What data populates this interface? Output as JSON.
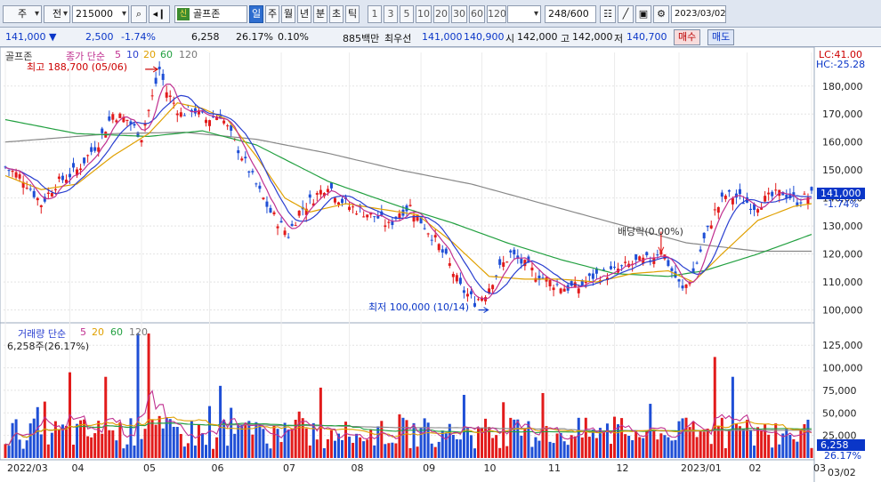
{
  "toolbar": {
    "mode": "주",
    "market": "전",
    "code": "215000",
    "badge": "신",
    "stock_name": "골프존",
    "periods": [
      "일",
      "주",
      "월",
      "년",
      "분",
      "초",
      "틱"
    ],
    "active_period": "일",
    "intervals": [
      "1",
      "3",
      "5",
      "10",
      "20",
      "30",
      "60",
      "120"
    ],
    "count": "248",
    "count_total": "/600",
    "date": "2023/03/02"
  },
  "quote": {
    "price": "141,000 ▼",
    "change": "2,500",
    "change_pct": "-1.74%",
    "volume": "6,258",
    "turnover": "26.17%",
    "ratio": "0.10%",
    "amount": "885백만",
    "best_bid_label": "최우선",
    "best_ask": "141,000",
    "best_bid": "140,900",
    "open_label": "시",
    "open": "142,000",
    "high_label": "고",
    "high": "142,000",
    "low_label": "저",
    "low": "140,700",
    "buy_label": "매수",
    "sell_label": "매도"
  },
  "price_panel": {
    "legend_name": "골프존",
    "legend_title": "종가 단순",
    "ma_periods": [
      "5",
      "10",
      "20",
      "60",
      "120"
    ],
    "ma_colors": [
      "#c03090",
      "#2a3fd0",
      "#e0a000",
      "#22a040",
      "#888888"
    ],
    "hc_labels": [
      "LC:41.00",
      "HC:-25.28"
    ],
    "max_label": "최고 188,700 (05/06)",
    "min_label": "최저 100,000 (10/14)",
    "dividend_label": "배당락(0.00%)",
    "current_price": "141,000",
    "current_change": "-1.74%",
    "y_ticks": [
      "180,000",
      "170,000",
      "160,000",
      "150,000",
      "140,000",
      "130,000",
      "120,000",
      "110,000",
      "100,000"
    ]
  },
  "volume_panel": {
    "legend_title": "거래량 단순",
    "ma_periods": [
      "5",
      "20",
      "60",
      "120"
    ],
    "sub_label": "6,258주(26.17%)",
    "current_volume": "6,258",
    "current_pct": "26.17%",
    "y_ticks": [
      "125,000",
      "100,000",
      "75,000",
      "50,000",
      "25,000"
    ]
  },
  "x_axis": {
    "labels": [
      "2022/03",
      "04",
      "05",
      "06",
      "07",
      "08",
      "09",
      "10",
      "11",
      "12",
      "2023/01",
      "02",
      "03"
    ],
    "right_label": "03/02"
  },
  "chart_data": {
    "type": "candlestick",
    "price_range": [
      97000,
      192000
    ],
    "volume_range": [
      0,
      140000
    ],
    "price_path": [
      [
        0,
        151000
      ],
      [
        5,
        147000
      ],
      [
        10,
        138000
      ],
      [
        14,
        145000
      ],
      [
        20,
        150000
      ],
      [
        26,
        160000
      ],
      [
        30,
        170000
      ],
      [
        34,
        168000
      ],
      [
        38,
        162000
      ],
      [
        41,
        176000
      ],
      [
        43,
        186000
      ],
      [
        45,
        178000
      ],
      [
        49,
        170000
      ],
      [
        52,
        172000
      ],
      [
        56,
        168000
      ],
      [
        60,
        170000
      ],
      [
        64,
        160000
      ],
      [
        68,
        150000
      ],
      [
        71,
        142000
      ],
      [
        74,
        135000
      ],
      [
        77,
        130000
      ],
      [
        79,
        127000
      ],
      [
        82,
        135000
      ],
      [
        86,
        140000
      ],
      [
        90,
        145000
      ],
      [
        93,
        140000
      ],
      [
        96,
        137000
      ],
      [
        100,
        135000
      ],
      [
        104,
        133000
      ],
      [
        107,
        130000
      ],
      [
        110,
        135000
      ],
      [
        113,
        137000
      ],
      [
        117,
        130000
      ],
      [
        120,
        125000
      ],
      [
        124,
        116000
      ],
      [
        127,
        108000
      ],
      [
        131,
        103000
      ],
      [
        134,
        106000
      ],
      [
        137,
        113000
      ],
      [
        141,
        120000
      ],
      [
        144,
        117000
      ],
      [
        148,
        113000
      ],
      [
        152,
        110000
      ],
      [
        156,
        108000
      ],
      [
        160,
        108000
      ],
      [
        164,
        112000
      ],
      [
        168,
        113000
      ],
      [
        172,
        115000
      ],
      [
        176,
        117000
      ],
      [
        180,
        118000
      ],
      [
        183,
        122000
      ],
      [
        186,
        114000
      ],
      [
        189,
        107000
      ],
      [
        192,
        113000
      ],
      [
        195,
        125000
      ],
      [
        198,
        135000
      ],
      [
        201,
        141000
      ],
      [
        205,
        140000
      ],
      [
        209,
        137000
      ],
      [
        213,
        140000
      ],
      [
        217,
        142000
      ],
      [
        221,
        139000
      ],
      [
        225,
        141000
      ]
    ],
    "ma120_path": [
      [
        0,
        160000
      ],
      [
        30,
        163000
      ],
      [
        50,
        163500
      ],
      [
        70,
        161000
      ],
      [
        90,
        156000
      ],
      [
        110,
        150000
      ],
      [
        130,
        145000
      ],
      [
        150,
        138000
      ],
      [
        170,
        131000
      ],
      [
        190,
        124000
      ],
      [
        210,
        121000
      ],
      [
        225,
        121000
      ]
    ],
    "ma60_path": [
      [
        0,
        168000
      ],
      [
        20,
        163000
      ],
      [
        40,
        162000
      ],
      [
        55,
        164000
      ],
      [
        70,
        159000
      ],
      [
        90,
        146000
      ],
      [
        110,
        137000
      ],
      [
        125,
        131000
      ],
      [
        140,
        124000
      ],
      [
        155,
        118000
      ],
      [
        170,
        113000
      ],
      [
        185,
        112000
      ],
      [
        195,
        114000
      ],
      [
        210,
        120000
      ],
      [
        225,
        127000
      ]
    ],
    "ma20_path": [
      [
        0,
        148000
      ],
      [
        10,
        143000
      ],
      [
        20,
        145000
      ],
      [
        30,
        155000
      ],
      [
        40,
        163000
      ],
      [
        48,
        174000
      ],
      [
        55,
        172000
      ],
      [
        62,
        168000
      ],
      [
        70,
        155000
      ],
      [
        78,
        140000
      ],
      [
        85,
        135000
      ],
      [
        95,
        138000
      ],
      [
        105,
        136000
      ],
      [
        115,
        134000
      ],
      [
        125,
        124000
      ],
      [
        135,
        112000
      ],
      [
        145,
        111000
      ],
      [
        155,
        111000
      ],
      [
        165,
        110000
      ],
      [
        175,
        113000
      ],
      [
        185,
        114000
      ],
      [
        192,
        110000
      ],
      [
        200,
        120000
      ],
      [
        210,
        132000
      ],
      [
        220,
        137000
      ],
      [
        225,
        138000
      ]
    ],
    "x_count": 226,
    "volume_highlights": [
      [
        37,
        138000
      ],
      [
        40,
        138000
      ],
      [
        198,
        112000
      ],
      [
        203,
        90000
      ],
      [
        18,
        95000
      ],
      [
        28,
        90000
      ],
      [
        60,
        80000
      ],
      [
        88,
        78000
      ],
      [
        128,
        70000
      ],
      [
        150,
        72000
      ]
    ]
  }
}
